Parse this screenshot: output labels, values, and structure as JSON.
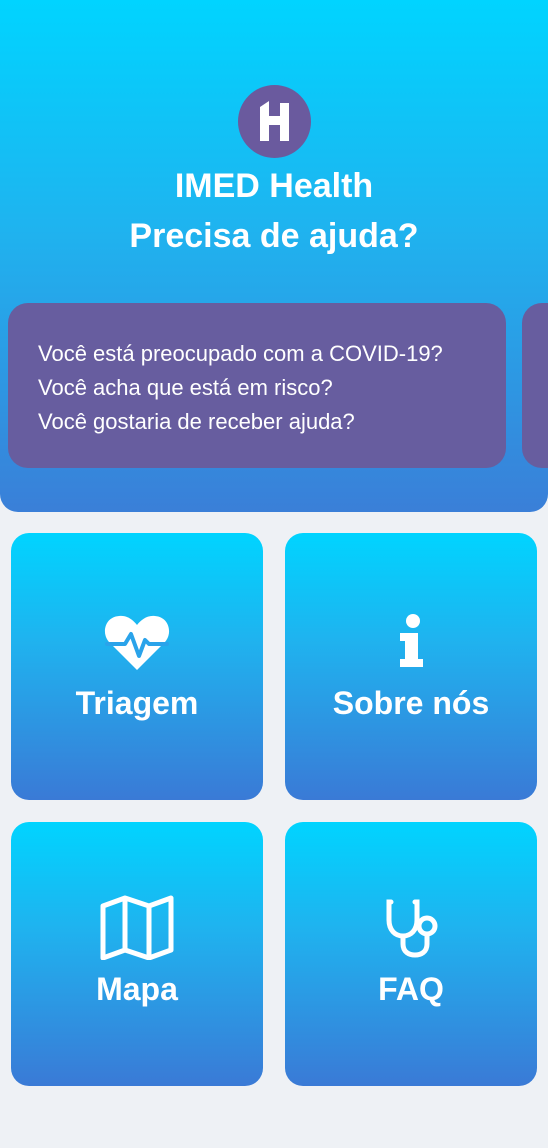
{
  "header": {
    "app_name": "IMED Health",
    "question": "Precisa de ajuda?"
  },
  "carousel": {
    "cards": [
      {
        "lines": [
          "Você está preocupado com a COVID-19?",
          "Você acha que está em risco?",
          "Você gostaria de receber ajuda?"
        ]
      }
    ]
  },
  "menu": {
    "tiles": [
      {
        "label": "Triagem",
        "icon": "heartbeat-icon"
      },
      {
        "label": "Sobre nós",
        "icon": "info-icon"
      },
      {
        "label": "Mapa",
        "icon": "map-icon"
      },
      {
        "label": "FAQ",
        "icon": "stethoscope-icon"
      }
    ]
  },
  "colors": {
    "gradient_top": "#00d4ff",
    "gradient_bottom": "#3a7ad6",
    "card_purple": "#675d9f",
    "logo_purple": "#6a5a9e",
    "background": "#eef1f5"
  }
}
